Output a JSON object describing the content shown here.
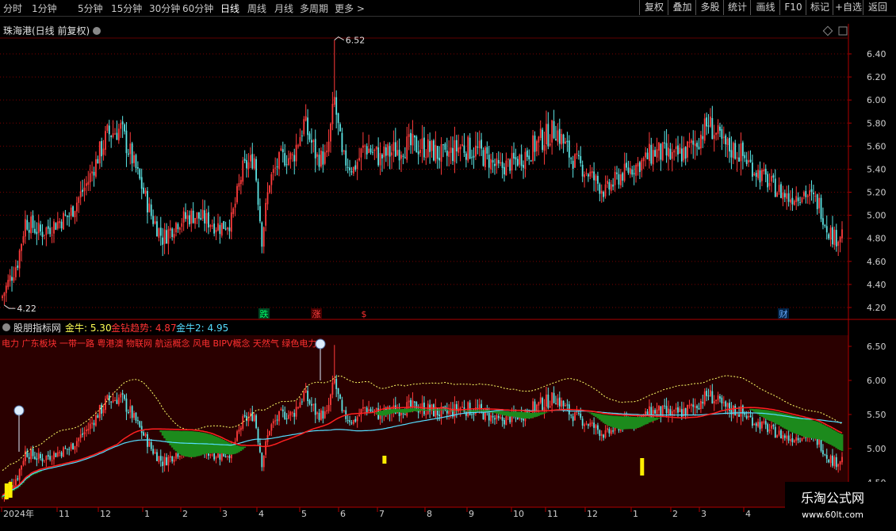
{
  "toolbar": {
    "periods": [
      "分时",
      "1分钟",
      "5分钟",
      "15分钟",
      "30分钟",
      "60分钟",
      "日线",
      "周线",
      "月线",
      "多周期",
      "更多 >"
    ],
    "active_index": 6,
    "right_buttons": [
      "复权",
      "叠加",
      "多股",
      "统计",
      "画线",
      "F10",
      "标记",
      "+自选",
      "返回"
    ]
  },
  "main_chart": {
    "title": "珠海港(日线 前复权)",
    "high_label": "6.52",
    "low_label": "4.22",
    "yticks": [
      "6.40",
      "6.20",
      "6.00",
      "5.80",
      "5.60",
      "5.40",
      "5.20",
      "5.00",
      "4.80",
      "4.60",
      "4.40",
      "4.20"
    ],
    "markers": [
      {
        "text": "跌",
        "color": "#00ff66",
        "bg": "#004422"
      },
      {
        "text": "涨",
        "color": "#ff4040",
        "bg": "#440000"
      },
      {
        "text": "$",
        "color": "#ff3030",
        "bg": ""
      },
      {
        "text": "财",
        "color": "#66aaff",
        "bg": "#002244"
      }
    ]
  },
  "indicator": {
    "name": "股朋指标网",
    "items": [
      {
        "label": "金牛: 5.30",
        "color": "#ffff55"
      },
      {
        "label": "金钻趋势: 4.87",
        "color": "#ff3333"
      },
      {
        "label": "金牛2: 4.95",
        "color": "#55ddff"
      }
    ],
    "concepts": "电力 广东板块 一带一路 粤港澳 物联网 航运概念 风电 BIPV概念 天然气 绿色电力",
    "yticks": [
      "6.50",
      "6.00",
      "5.50",
      "5.00",
      "4.50"
    ]
  },
  "xaxis": {
    "labels": [
      "2024年",
      "11",
      "12",
      "1",
      "2",
      "3",
      "4",
      "5",
      "6",
      "7",
      "8",
      "9",
      "10",
      "11",
      "12",
      "1",
      "2",
      "3",
      "4"
    ]
  },
  "watermark": {
    "line1": "乐淘公式网",
    "line2": "www.60lt.com"
  },
  "chart_data": {
    "type": "candlestick",
    "title": "珠海港(日线 前复权)",
    "ylim": [
      4.15,
      6.65
    ],
    "high": 6.52,
    "low": 4.22,
    "price_path": [
      [
        0,
        4.3
      ],
      [
        8,
        4.6
      ],
      [
        12,
        4.95
      ],
      [
        20,
        4.85
      ],
      [
        35,
        5.0
      ],
      [
        45,
        5.3
      ],
      [
        55,
        5.7
      ],
      [
        62,
        5.75
      ],
      [
        70,
        5.4
      ],
      [
        78,
        5.0
      ],
      [
        84,
        4.8
      ],
      [
        92,
        4.95
      ],
      [
        100,
        5.0
      ],
      [
        108,
        4.95
      ],
      [
        114,
        4.9
      ],
      [
        120,
        4.95
      ],
      [
        126,
        5.4
      ],
      [
        132,
        5.5
      ],
      [
        136,
        4.8
      ],
      [
        140,
        5.3
      ],
      [
        146,
        5.5
      ],
      [
        152,
        5.5
      ],
      [
        158,
        5.8
      ],
      [
        165,
        5.5
      ],
      [
        170,
        5.5
      ],
      [
        174,
        6.0
      ],
      [
        178,
        5.5
      ],
      [
        184,
        5.4
      ],
      [
        190,
        5.6
      ],
      [
        198,
        5.5
      ],
      [
        210,
        5.6
      ],
      [
        220,
        5.6
      ],
      [
        232,
        5.5
      ],
      [
        240,
        5.6
      ],
      [
        250,
        5.55
      ],
      [
        260,
        5.4
      ],
      [
        272,
        5.5
      ],
      [
        282,
        5.65
      ],
      [
        290,
        5.75
      ],
      [
        298,
        5.5
      ],
      [
        308,
        5.35
      ],
      [
        316,
        5.2
      ],
      [
        324,
        5.35
      ],
      [
        334,
        5.45
      ],
      [
        342,
        5.55
      ],
      [
        352,
        5.5
      ],
      [
        362,
        5.6
      ],
      [
        370,
        5.8
      ],
      [
        378,
        5.6
      ],
      [
        386,
        5.55
      ],
      [
        394,
        5.4
      ],
      [
        404,
        5.25
      ],
      [
        412,
        5.15
      ],
      [
        420,
        5.2
      ],
      [
        428,
        5.1
      ],
      [
        432,
        4.9
      ],
      [
        436,
        4.8
      ],
      [
        440,
        4.85
      ]
    ]
  }
}
